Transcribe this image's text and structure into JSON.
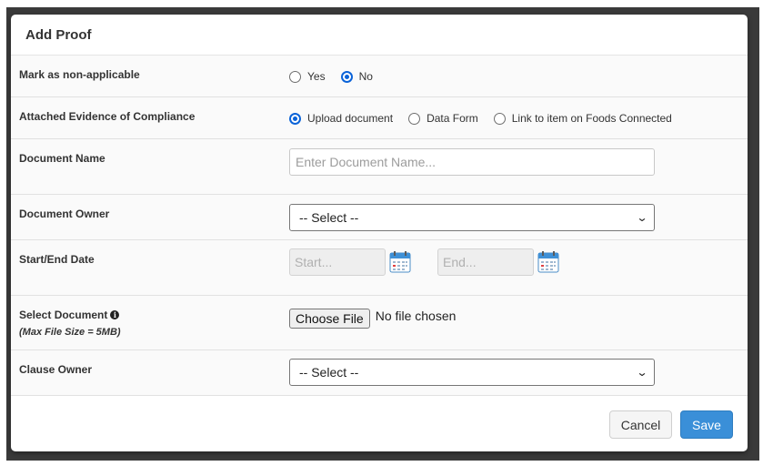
{
  "modal": {
    "title": "Add Proof"
  },
  "rows": {
    "non_applicable": {
      "label": "Mark as non-applicable",
      "options": [
        "Yes",
        "No"
      ],
      "selected": "No"
    },
    "evidence": {
      "label": "Attached Evidence of Compliance",
      "options": [
        "Upload document",
        "Data Form",
        "Link to item on Foods Connected"
      ],
      "selected": "Upload document"
    },
    "document_name": {
      "label": "Document Name",
      "placeholder": "Enter Document Name..."
    },
    "document_owner": {
      "label": "Document Owner",
      "value": "-- Select --"
    },
    "dates": {
      "label": "Start/End Date",
      "start_placeholder": "Start...",
      "end_placeholder": "End..."
    },
    "select_document": {
      "label": "Select Document",
      "note": "(Max File Size = 5MB)",
      "button": "Choose File",
      "status": "No file chosen"
    },
    "clause_owner": {
      "label": "Clause Owner",
      "value": "-- Select --"
    }
  },
  "footer": {
    "cancel_label": "Cancel",
    "save_label": "Save"
  },
  "icons": {
    "info": "info-icon",
    "calendar": "calendar-icon",
    "dropdown": "chevron-down-icon"
  },
  "colors": {
    "primary": "#3a8fd8",
    "radio_checked": "#0b63d8"
  }
}
